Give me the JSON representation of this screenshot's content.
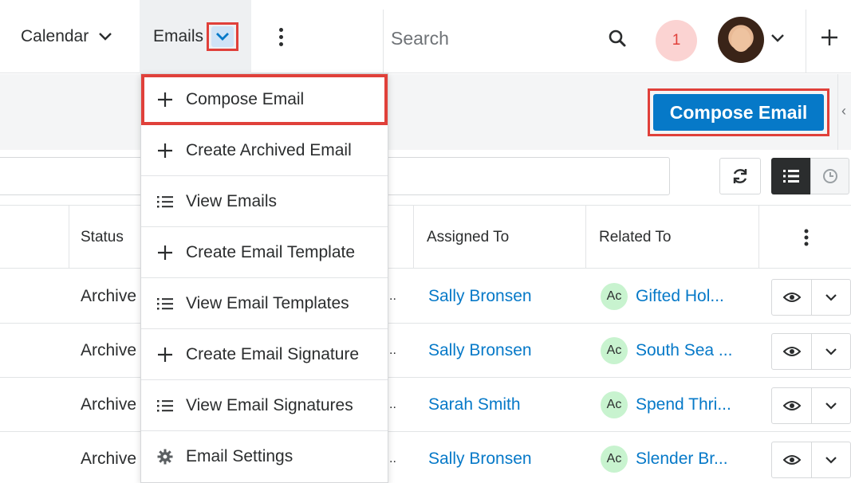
{
  "nav": {
    "calendar_label": "Calendar",
    "emails_label": "Emails",
    "search_placeholder": "Search",
    "notification_count": "1"
  },
  "header": {
    "compose_button_label": "Compose Email"
  },
  "table": {
    "columns": {
      "status": "Status",
      "assigned_to": "Assigned To",
      "related_to": "Related To"
    },
    "rows": [
      {
        "status": "Archive",
        "ellipsis": "..",
        "assigned_to": "Sally Bronsen",
        "related_badge": "Ac",
        "related_to": "Gifted Hol..."
      },
      {
        "status": "Archive",
        "ellipsis": "..",
        "assigned_to": "Sally Bronsen",
        "related_badge": "Ac",
        "related_to": "South Sea ..."
      },
      {
        "status": "Archive",
        "ellipsis": "..",
        "assigned_to": "Sarah Smith",
        "related_badge": "Ac",
        "related_to": "Spend Thri..."
      },
      {
        "status": "Archive",
        "ellipsis": "..",
        "assigned_to": "Sally Bronsen",
        "related_badge": "Ac",
        "related_to": "Slender Br..."
      }
    ]
  },
  "menu": {
    "items": [
      {
        "label": "Compose Email",
        "icon": "plus-icon"
      },
      {
        "label": "Create Archived Email",
        "icon": "plus-icon"
      },
      {
        "label": "View Emails",
        "icon": "list-icon"
      },
      {
        "label": "Create Email Template",
        "icon": "plus-icon"
      },
      {
        "label": "View Email Templates",
        "icon": "list-icon"
      },
      {
        "label": "Create Email Signature",
        "icon": "plus-icon"
      },
      {
        "label": "View Email Signatures",
        "icon": "list-icon"
      },
      {
        "label": "Email Settings",
        "icon": "gear-icon"
      }
    ]
  },
  "colors": {
    "accent": "#0679c8",
    "highlight_border": "#e0403a",
    "badge_bg": "#c8f3cf",
    "notification_bg": "#fbd3d2"
  }
}
